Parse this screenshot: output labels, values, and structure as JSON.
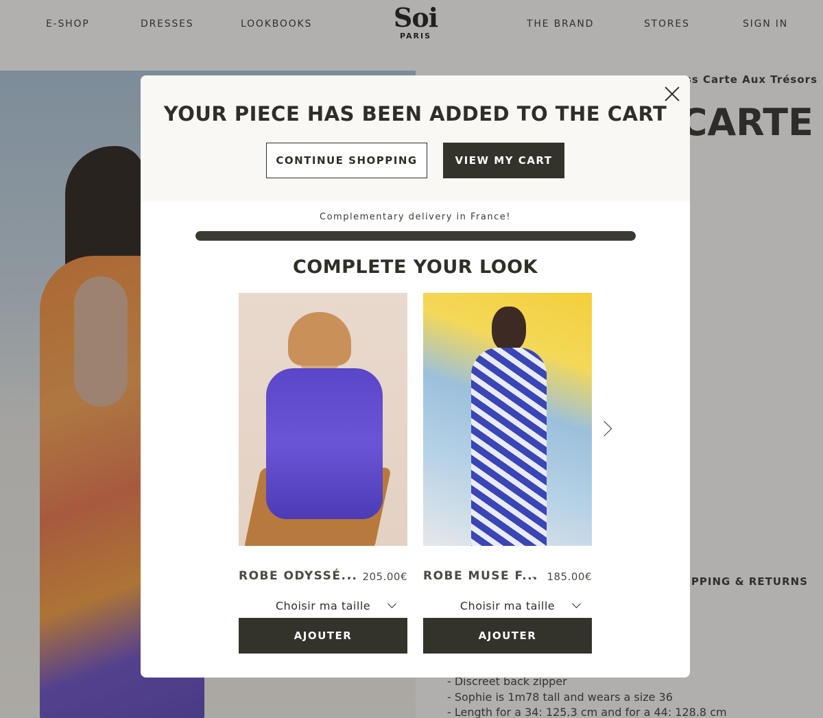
{
  "nav": {
    "items": [
      "E-SHOP",
      "DRESSES",
      "LOOKBOOKS",
      "THE BRAND",
      "STORES",
      "SIGN IN"
    ]
  },
  "logo": {
    "main": "Soi",
    "sub": "PARIS"
  },
  "product_page": {
    "breadcrumb": "ess Carte Aux Trésors",
    "title_fragment": "S CARTE",
    "shipping_tab": "SHIPPING & RETURNS",
    "details": [
      "- Discreet back zipper",
      "- Sophie is 1m78 tall and wears a size 36",
      "- Length for a 34: 125.3 cm and for a 44: 128.8 cm"
    ]
  },
  "modal": {
    "title": "YOUR PIECE HAS BEEN ADDED TO THE CART",
    "continue_label": "CONTINUE SHOPPING",
    "view_cart_label": "VIEW MY CART",
    "delivery_text": "Complementary delivery in France!",
    "delivery_progress": 1.0,
    "look_title": "COMPLETE YOUR LOOK",
    "products": [
      {
        "name": "ROBE ODYSSÉ...",
        "separator": "-",
        "price": "205.00€",
        "size_label": "Choisir ma taille",
        "add_label": "AJOUTER"
      },
      {
        "name": "ROBE MUSE F...",
        "separator": "-",
        "price": "185.00€",
        "size_label": "Choisir ma taille",
        "add_label": "AJOUTER"
      }
    ]
  },
  "colors": {
    "dark_button": "#34332a",
    "text": "#2f2e28",
    "modal_header_bg": "#faf8f5"
  }
}
